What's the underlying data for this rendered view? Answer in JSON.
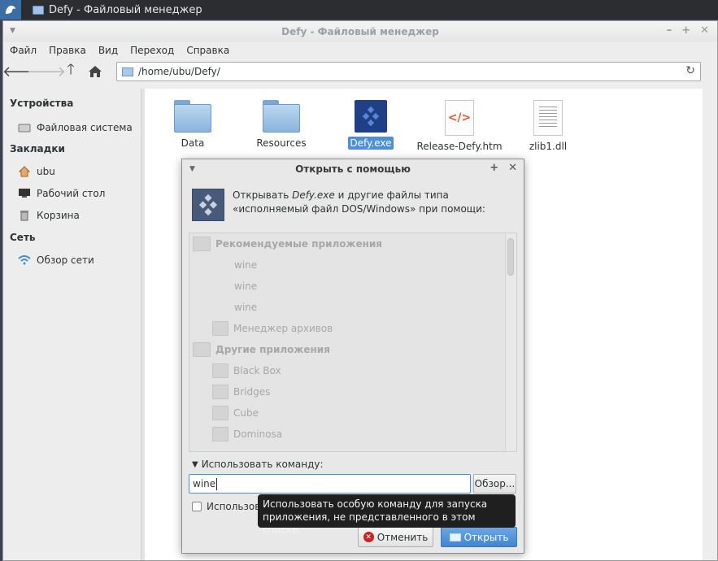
{
  "panel": {
    "task_title": "Defy - Файловый менеджер"
  },
  "window": {
    "title": "Defy - Файловый менеджер"
  },
  "menu": [
    "Файл",
    "Правка",
    "Вид",
    "Переход",
    "Справка"
  ],
  "location": {
    "path": "/home/ubu/Defy/"
  },
  "sidebar": {
    "devices_header": "Устройства",
    "filesystem": "Файловая система",
    "bookmarks_header": "Закладки",
    "home": "ubu",
    "desktop": "Рабочий стол",
    "trash": "Корзина",
    "network_header": "Сеть",
    "browse_network": "Обзор сети"
  },
  "files": [
    {
      "name": "Data",
      "type": "folder"
    },
    {
      "name": "Resources",
      "type": "folder"
    },
    {
      "name": "Defy.exe",
      "type": "exe",
      "selected": true
    },
    {
      "name": "Release-Defy.htm",
      "type": "htm"
    },
    {
      "name": "zlib1.dll",
      "type": "dll"
    }
  ],
  "dialog": {
    "title": "Открыть с помощью",
    "msg_prefix": "Открывать ",
    "msg_file": "Defy.exe",
    "msg_suffix": " и другие файлы типа «исполняемый файл DOS/Windows» при помощи:",
    "recommended_header": "Рекомендуемые приложения",
    "recommended": [
      "wine",
      "wine",
      "wine",
      "Менеджер архивов"
    ],
    "other_header": "Другие приложения",
    "other": [
      "Black Box",
      "Bridges",
      "Cube",
      "Dominosa"
    ],
    "use_command_label": "Использовать команду:",
    "command_value": "wine",
    "browse_label": "Обзор...",
    "checkbox_label": "Использов",
    "cancel_label": "Отменить",
    "open_label": "Открыть"
  },
  "tooltip": {
    "text": "Использовать особую команду для запуска приложения, не представленного в этом списке."
  }
}
